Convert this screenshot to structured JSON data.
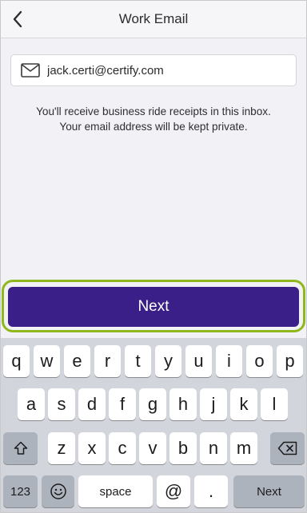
{
  "nav": {
    "title": "Work Email",
    "back_icon": "chevron-left-icon"
  },
  "email": {
    "value": "jack.certi@certify.com",
    "icon": "mail-icon"
  },
  "info": {
    "line1": "You'll receive business ride receipts in this inbox.",
    "line2": "Your email address will be kept private."
  },
  "next_button": {
    "label": "Next",
    "color": "#3a1f88",
    "highlight_color": "#8fb81e"
  },
  "keyboard": {
    "row1": [
      "q",
      "w",
      "e",
      "r",
      "t",
      "y",
      "u",
      "i",
      "o",
      "p"
    ],
    "row2": [
      "a",
      "s",
      "d",
      "f",
      "g",
      "h",
      "j",
      "k",
      "l"
    ],
    "row3": [
      "z",
      "x",
      "c",
      "v",
      "b",
      "n",
      "m"
    ],
    "numbers_label": "123",
    "space_label": "space",
    "at_label": "@",
    "dot_label": ".",
    "next_label": "Next",
    "shift_icon": "shift-icon",
    "delete_icon": "backspace-icon",
    "emoji_icon": "emoji-icon"
  }
}
